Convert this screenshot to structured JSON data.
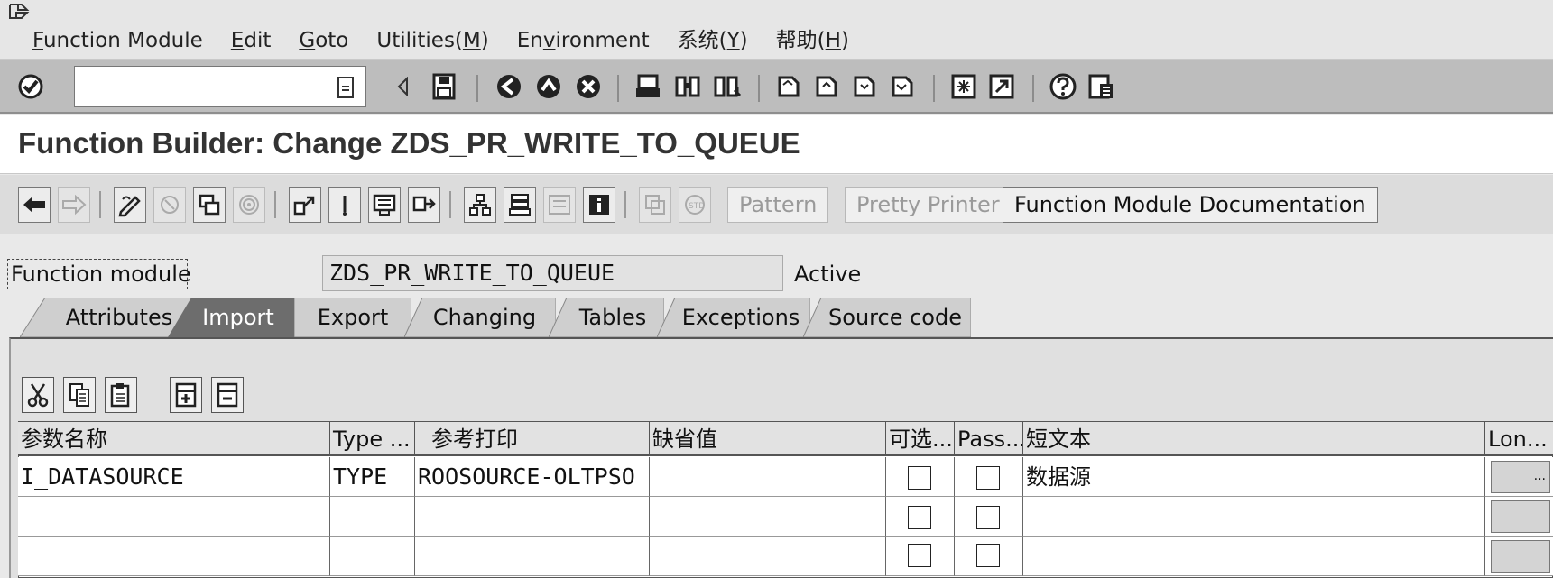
{
  "menu": {
    "items": [
      {
        "label": "Function Module",
        "mnemonic": "F"
      },
      {
        "label": "Edit",
        "mnemonic": "E"
      },
      {
        "label": "Goto",
        "mnemonic": "G"
      },
      {
        "label": "Utilities(M)",
        "mnemonic": "M"
      },
      {
        "label": "Environment",
        "mnemonic": "v"
      },
      {
        "label": "系统(Y)",
        "mnemonic": "Y"
      },
      {
        "label": "帮助(H)",
        "mnemonic": "H"
      }
    ]
  },
  "command_field": {
    "value": ""
  },
  "title": "Function Builder: Change ZDS_PR_WRITE_TO_QUEUE",
  "app_toolbar": {
    "pattern_label": "Pattern",
    "pretty_printer_label": "Pretty Printer",
    "documentation_label": "Function Module Documentation"
  },
  "function_module": {
    "label": "Function module",
    "value": "ZDS_PR_WRITE_TO_QUEUE",
    "status": "Active"
  },
  "tabs": [
    {
      "label": "Attributes",
      "active": false
    },
    {
      "label": "Import",
      "active": true
    },
    {
      "label": "Export",
      "active": false
    },
    {
      "label": "Changing",
      "active": false
    },
    {
      "label": "Tables",
      "active": false
    },
    {
      "label": "Exceptions",
      "active": false
    },
    {
      "label": "Source code",
      "active": false
    }
  ],
  "table": {
    "headers": [
      "参数名称",
      "Type ...",
      "参考打印",
      "缺省值",
      "可选...",
      "Pass...",
      "短文本",
      "Lon..."
    ],
    "rows": [
      {
        "name": "I_DATASOURCE",
        "type": "TYPE",
        "ref": "ROOSOURCE-OLTPSO",
        "default": "",
        "optional": false,
        "pass": false,
        "text": "数据源",
        "long": "..."
      },
      {
        "name": "",
        "type": "",
        "ref": "",
        "default": "",
        "optional": false,
        "pass": false,
        "text": "",
        "long": ""
      },
      {
        "name": "",
        "type": "",
        "ref": "",
        "default": "",
        "optional": false,
        "pass": false,
        "text": "",
        "long": ""
      }
    ]
  },
  "colors": {
    "active_tab": "#6d6d6d",
    "inactive_tab": "#cfcfcf",
    "toolbar": "#bdbdbd"
  }
}
